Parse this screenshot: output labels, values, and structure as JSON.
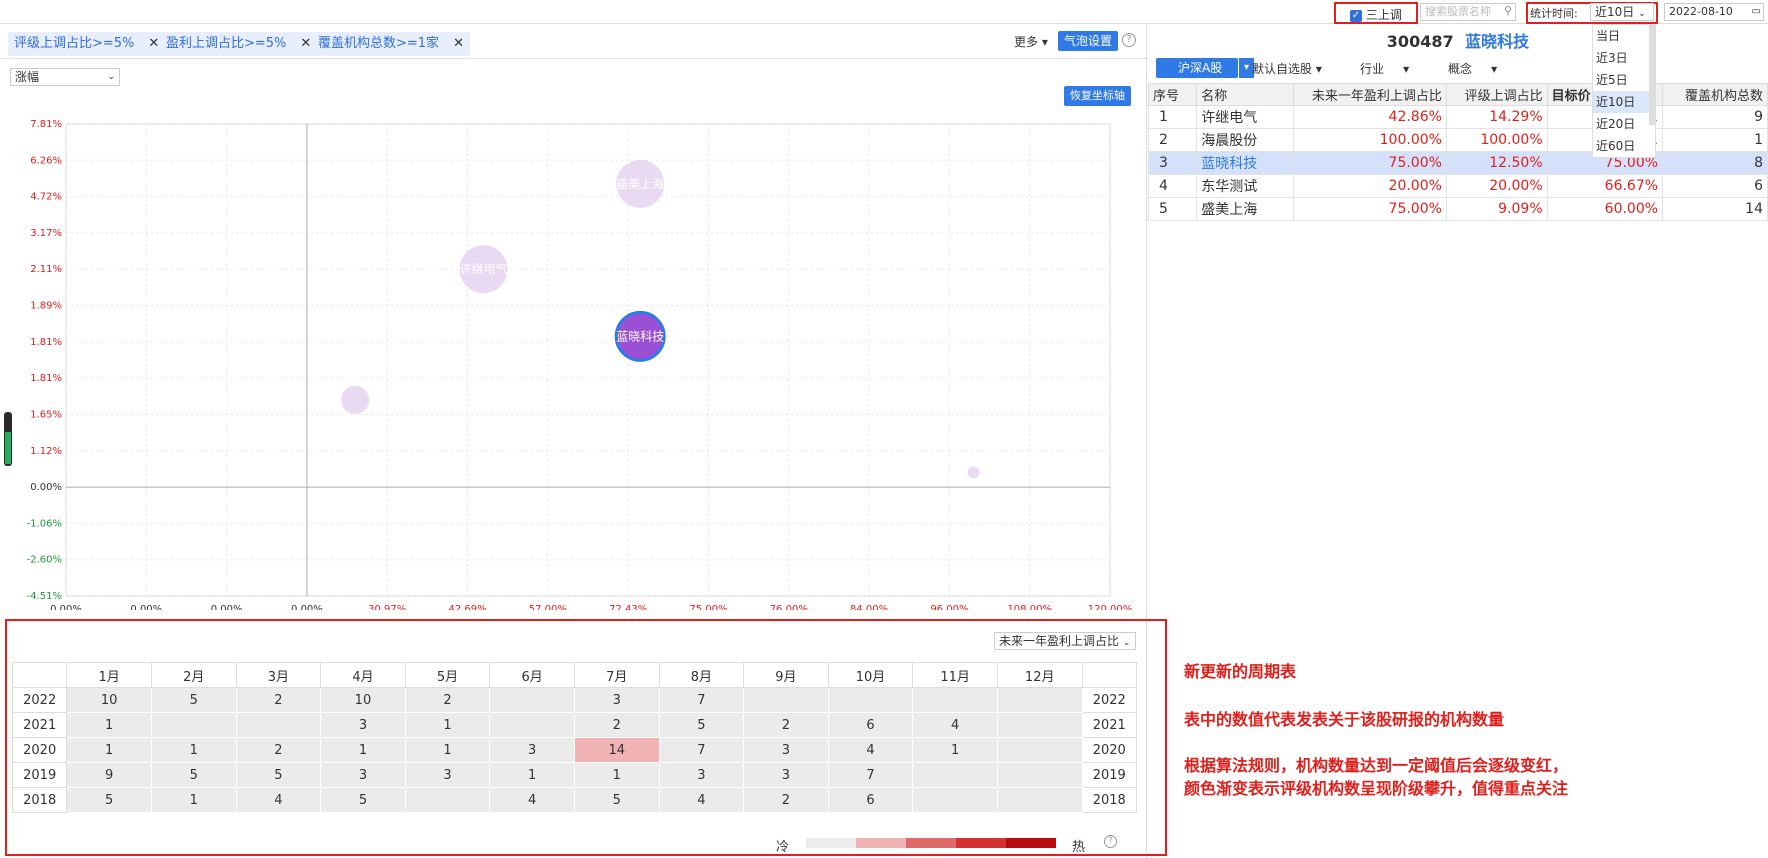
{
  "topbar": {
    "checkbox_label": "三上调",
    "search_placeholder": "搜索股票名称",
    "period_label": "统计时间:",
    "period_value": "近10日",
    "date_value": "2022-08-10",
    "period_options": [
      "当日",
      "近3日",
      "近5日",
      "近10日",
      "近20日",
      "近60日"
    ]
  },
  "filters": [
    {
      "label": "评级上调占比>=5%"
    },
    {
      "label": "盈利上调占比>=5%"
    },
    {
      "label": "覆盖机构总数>=1家"
    }
  ],
  "toolbar": {
    "more_label": "更多",
    "bubble_settings_label": "气泡设置",
    "help_icon": "?"
  },
  "chart_select": {
    "value": "涨幅"
  },
  "reset_axis_label": "恢复坐标轴",
  "chart_data": {
    "type": "scatter",
    "y_ticks": [
      "7.81%",
      "6.26%",
      "4.72%",
      "3.17%",
      "2.11%",
      "1.89%",
      "1.81%",
      "1.81%",
      "1.65%",
      "1.12%",
      "0.00%",
      "-1.06%",
      "-2.60%",
      "-4.51%"
    ],
    "x_ticks": [
      "0.00%",
      "0.00%",
      "0.00%",
      "0.00%",
      "30.97%",
      "42.69%",
      "57.00%",
      "72.43%",
      "75.00%",
      "76.00%",
      "84.00%",
      "96.00%",
      "108.00%",
      "120.00%"
    ],
    "points": [
      {
        "name": "许继电气",
        "x_tick": 5.2,
        "y_tick": 4.0,
        "size": 24,
        "selected": false,
        "show_label": true
      },
      {
        "name": "盛美上海",
        "x_tick": 7.15,
        "y_tick": 1.65,
        "size": 24,
        "selected": false,
        "show_label": true
      },
      {
        "name": "蓝晓科技",
        "x_tick": 7.15,
        "y_tick": 5.85,
        "size": 24,
        "selected": true,
        "show_label": true
      },
      {
        "name": "东华测试",
        "x_tick": 3.6,
        "y_tick": 7.6,
        "size": 14,
        "selected": false,
        "show_label": false
      },
      {
        "name": "海晨股份",
        "x_tick": 11.3,
        "y_tick": 9.6,
        "size": 6,
        "selected": false,
        "show_label": false
      }
    ]
  },
  "detail": {
    "code": "300487",
    "name": "蓝晓科技",
    "tabs": [
      "沪深A股",
      "默认自选股",
      "行业",
      "概念"
    ],
    "columns": [
      "序号",
      "名称",
      "未来一年盈利上调占比",
      "评级上调占比",
      "目标价",
      "覆盖机构总数"
    ],
    "rows": [
      {
        "idx": "1",
        "name": "许继电气",
        "profit": "42.86%",
        "rating": "14.29%",
        "target": "1",
        "cover": "9"
      },
      {
        "idx": "2",
        "name": "海晨股份",
        "profit": "100.00%",
        "rating": "100.00%",
        "target": "1",
        "cover": "1"
      },
      {
        "idx": "3",
        "name": "蓝晓科技",
        "profit": "75.00%",
        "rating": "12.50%",
        "target": "75.00%",
        "cover": "8"
      },
      {
        "idx": "4",
        "name": "东华测试",
        "profit": "20.00%",
        "rating": "20.00%",
        "target": "66.67%",
        "cover": "6"
      },
      {
        "idx": "5",
        "name": "盛美上海",
        "profit": "75.00%",
        "rating": "9.09%",
        "target": "60.00%",
        "cover": "14"
      }
    ]
  },
  "cycle": {
    "metric_select": "未来一年盈利上调占比",
    "months": [
      "1月",
      "2月",
      "3月",
      "4月",
      "5月",
      "6月",
      "7月",
      "8月",
      "9月",
      "10月",
      "11月",
      "12月"
    ],
    "rows": [
      {
        "year": "2022",
        "values": [
          "10",
          "5",
          "2",
          "10",
          "2",
          "",
          "3",
          "7",
          "",
          "",
          "",
          ""
        ]
      },
      {
        "year": "2021",
        "values": [
          "1",
          "",
          "",
          "3",
          "1",
          "",
          "2",
          "5",
          "2",
          "6",
          "4",
          ""
        ]
      },
      {
        "year": "2020",
        "values": [
          "1",
          "1",
          "2",
          "1",
          "1",
          "3",
          "14",
          "7",
          "3",
          "4",
          "1",
          ""
        ]
      },
      {
        "year": "2019",
        "values": [
          "9",
          "5",
          "5",
          "3",
          "3",
          "1",
          "1",
          "3",
          "3",
          "7",
          "",
          ""
        ]
      },
      {
        "year": "2018",
        "values": [
          "5",
          "1",
          "4",
          "5",
          "",
          "4",
          "5",
          "4",
          "2",
          "6",
          "",
          ""
        ]
      }
    ],
    "legend_cold": "冷",
    "legend_hot": "热"
  },
  "annotation": {
    "title": "新更新的周期表",
    "line2": "表中的数值代表发表关于该股研报的机构数量",
    "line3": "根据算法规则，机构数量达到一定阈值后会逐级变红，",
    "line4": "颜色渐变表示评级机构数呈现阶级攀升，值得重点关注"
  },
  "colors": {
    "accent": "#2f7ae5",
    "red": "#e0201c",
    "hot_cell": "#f0b3b3"
  }
}
